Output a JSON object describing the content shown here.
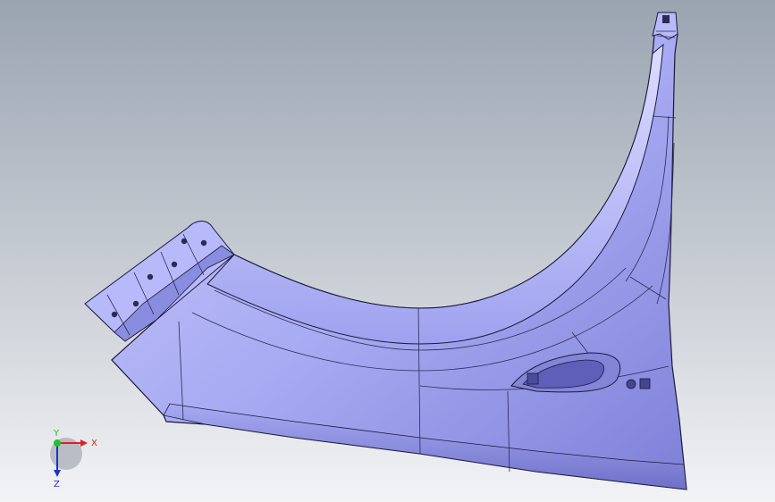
{
  "viewport": {
    "background_top": "#9aa4b1",
    "background_bottom": "#f2f3f5",
    "model": {
      "part": "fender-panel",
      "surface_color": "#a6a8f4",
      "edge_color": "#1a1a3a"
    }
  },
  "triad": {
    "x_label": "X",
    "y_label": "Y",
    "z_label": "Z",
    "x_color": "#e02020",
    "y_color": "#20c030",
    "z_color": "#2030d0"
  }
}
